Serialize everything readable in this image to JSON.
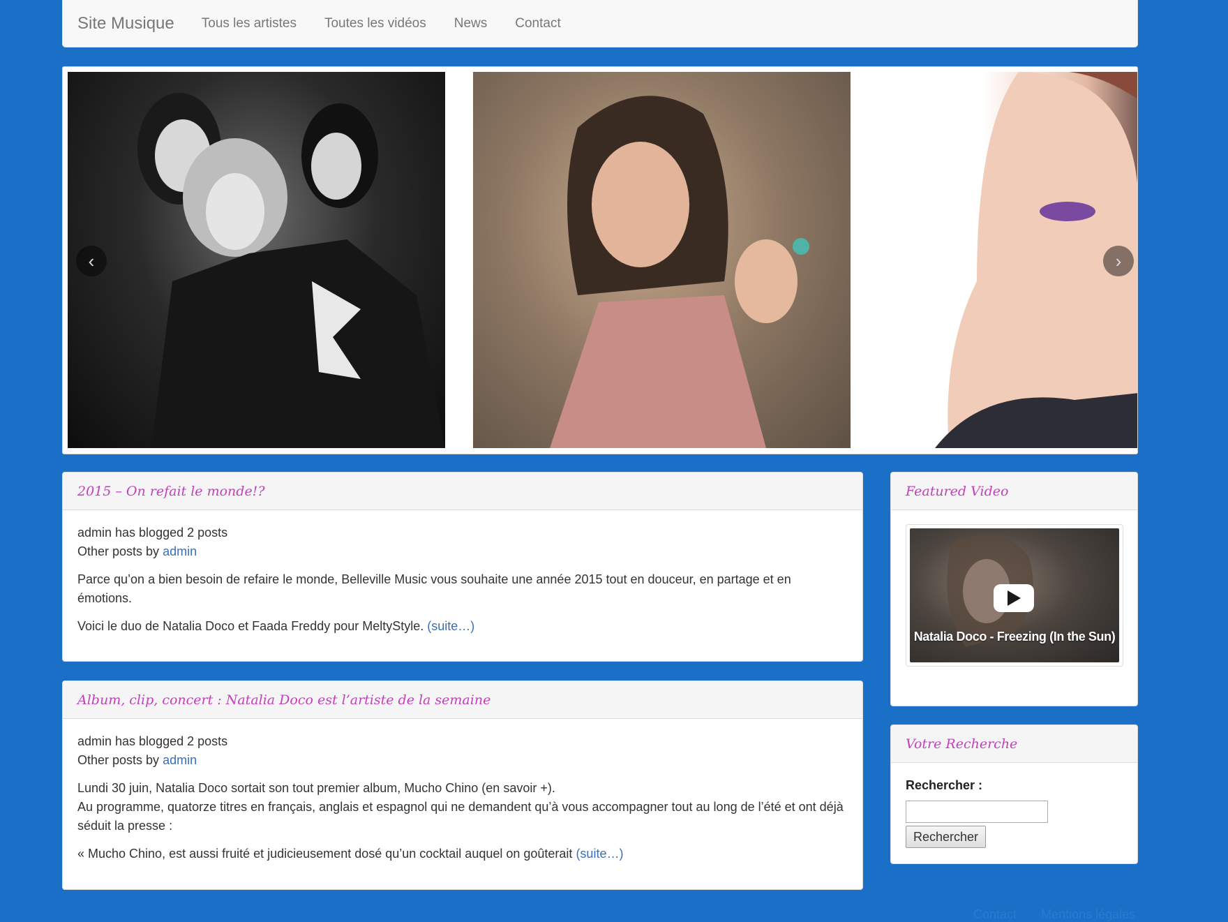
{
  "navbar": {
    "brand": "Site Musique",
    "items": [
      {
        "label": "Tous les artistes"
      },
      {
        "label": "Toutes les vidéos"
      },
      {
        "label": "News"
      },
      {
        "label": "Contact"
      }
    ]
  },
  "carousel": {
    "prev_icon": "chevron-left-icon",
    "next_icon": "chevron-right-icon",
    "prev_glyph": "‹",
    "next_glyph": "›"
  },
  "posts": [
    {
      "title": "2015 – On refait le monde!?",
      "meta_line1": "admin has blogged 2 posts",
      "meta_prefix": "Other posts by ",
      "meta_author": "admin",
      "paragraphs": [
        "Parce qu’on a bien besoin de refaire le monde, Belleville Music vous souhaite une année 2015 tout en douceur, en partage et en émotions."
      ],
      "last_text": "Voici le duo de Natalia Doco et Faada Freddy pour MeltyStyle. ",
      "more_link": "(suite…)"
    },
    {
      "title": "Album, clip, concert : Natalia Doco est l’artiste de la semaine",
      "meta_line1": "admin has blogged 2 posts",
      "meta_prefix": "Other posts by ",
      "meta_author": "admin",
      "paragraphs": [
        "Lundi 30 juin, Natalia Doco sortait son tout premier album, Mucho Chino (en savoir +).",
        "Au programme, quatorze titres en français, anglais et espagnol qui ne demandent qu’à vous accompagner tout au long de l’été et ont déjà séduit la presse :"
      ],
      "last_text": "« Mucho Chino, est aussi fruité et judicieusement dosé qu’un cocktail auquel on goûterait ",
      "more_link": "(suite…)"
    }
  ],
  "featured_video": {
    "heading": "Featured Video",
    "title": "Natalia Doco - Freezing (In the Sun)",
    "play_icon": "play-icon"
  },
  "search": {
    "heading": "Votre Recherche",
    "label": "Rechercher :",
    "input_value": "",
    "button": "Rechercher"
  },
  "footer": {
    "links": [
      "Contact",
      "Mentions légales"
    ]
  },
  "colors": {
    "background": "#1a6fc6",
    "heading_pink": "#c43fbe",
    "link": "#3a6fb5"
  }
}
